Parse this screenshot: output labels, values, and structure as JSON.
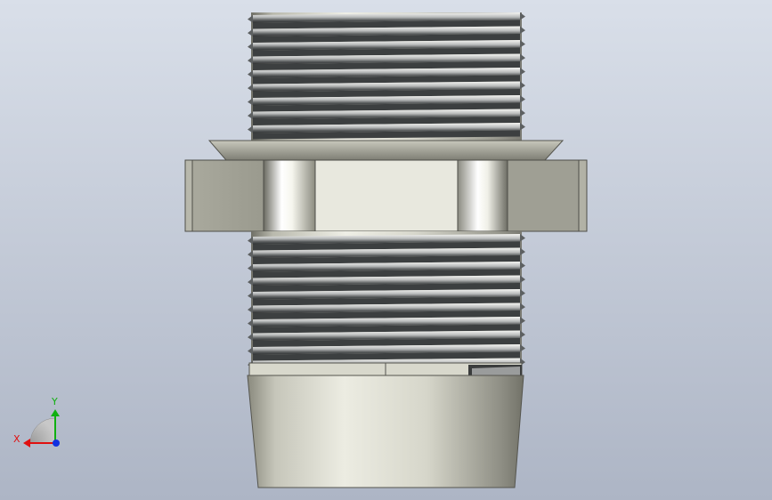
{
  "viewport": {
    "background_top": "#d8dee8",
    "background_bottom": "#aeb6c6"
  },
  "part": {
    "name": "hex-nipple-fitting",
    "thread_color_light": "#f2f2ee",
    "thread_color_dark": "#4a4d4e",
    "body_color": "#e8e8de",
    "shadow_color": "#8c8c82"
  },
  "triad": {
    "x_label": "X",
    "y_label": "Y",
    "x_color": "#e01010",
    "y_color": "#10b010",
    "z_color": "#1030e0"
  }
}
